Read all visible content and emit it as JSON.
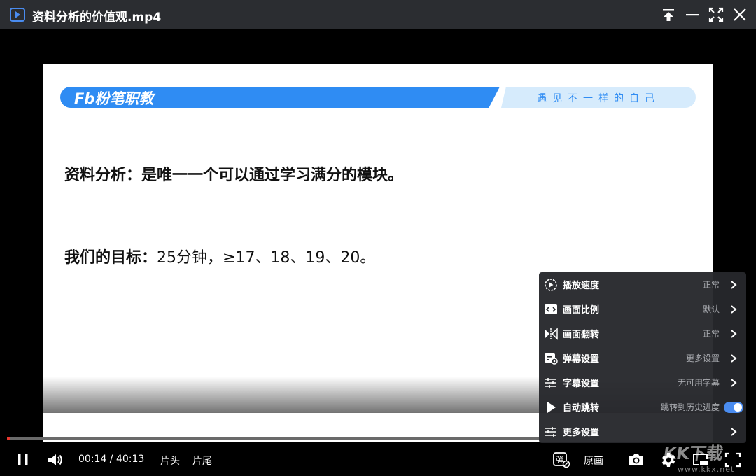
{
  "window": {
    "title": "资料分析的价值观.mp4"
  },
  "slide": {
    "logo_text": "Fb粉笔职教",
    "slogan": "遇见不一样的自己",
    "line1": "资料分析：是唯一一个可以通过学习满分的模块。",
    "line2_label": "我们的目标：",
    "line2_text": "25分钟，≥17、18、19、20。"
  },
  "player": {
    "current_time": "00:14",
    "separator": " / ",
    "duration": "40:13",
    "intro_label": "片头",
    "outro_label": "片尾",
    "quality_label": "原画",
    "danmaku_label": "弹",
    "progress_fraction": 0.006
  },
  "settings_menu": {
    "items": [
      {
        "label": "播放速度",
        "value": "正常",
        "icon": "play-speed-icon"
      },
      {
        "label": "画面比例",
        "value": "默认",
        "icon": "aspect-ratio-icon"
      },
      {
        "label": "画面翻转",
        "value": "正常",
        "icon": "flip-icon"
      },
      {
        "label": "弹幕设置",
        "value": "更多设置",
        "icon": "danmaku-settings-icon"
      },
      {
        "label": "字幕设置",
        "value": "无可用字幕",
        "icon": "subtitle-settings-icon"
      },
      {
        "label": "自动跳转",
        "value": "跳转到历史进度",
        "icon": "auto-jump-icon",
        "toggle_on": true
      },
      {
        "label": "更多设置",
        "value": "",
        "icon": "more-settings-icon"
      }
    ]
  },
  "watermark": {
    "text": "KK下载",
    "url": "www.kkx.net"
  },
  "colors": {
    "accent": "#4a8cf0",
    "brand_blue": "#2f8cf3",
    "progress": "#e8382f",
    "titlebar": "#2b2d31"
  }
}
